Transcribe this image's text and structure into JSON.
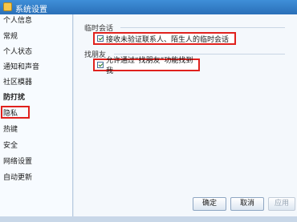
{
  "window": {
    "title": "系统设置"
  },
  "sidebar": {
    "items": [
      {
        "label": "个人信息"
      },
      {
        "label": "常规"
      },
      {
        "label": "个人状态"
      },
      {
        "label": "通知和声音"
      },
      {
        "label": "社区模器"
      },
      {
        "label": "防打扰"
      },
      {
        "label": "隐私"
      },
      {
        "label": "热键"
      },
      {
        "label": "安全"
      },
      {
        "label": "网络设置"
      },
      {
        "label": "自动更新"
      }
    ],
    "selected": "防打扰"
  },
  "main": {
    "group1": {
      "label": "临时会话",
      "option": {
        "label": "接收未验证联系人、陌生人的临时会话",
        "checked": true
      }
    },
    "group2": {
      "label": "找朋友",
      "option": {
        "label": "允许通过“找朋友”功能找到我",
        "checked": true
      }
    }
  },
  "buttons": {
    "ok": "确定",
    "cancel": "取消",
    "apply": "应用"
  },
  "colors": {
    "highlight": "#e0211d",
    "titlebar": "#2a6fb8"
  }
}
